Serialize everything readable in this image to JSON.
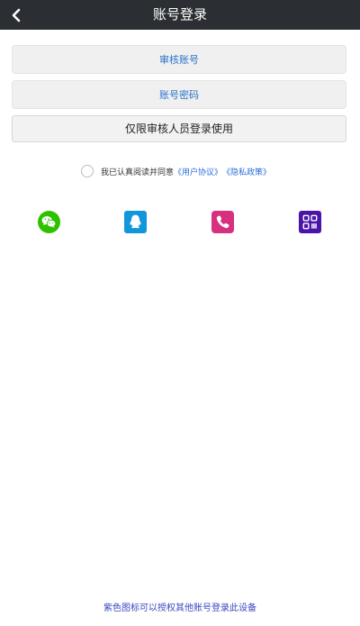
{
  "header": {
    "title": "账号登录",
    "back_icon": "chevron-left-icon"
  },
  "form": {
    "account_placeholder": "审核账号",
    "password_placeholder": "账号密码",
    "login_button_label": "仅限审核人员登录使用"
  },
  "agreement": {
    "prefix": "我已认真阅读并同意",
    "user_agreement": "《用户协议》",
    "privacy_policy": "《隐私政策》",
    "checked": false
  },
  "social_logins": [
    {
      "name": "wechat",
      "icon": "wechat-icon",
      "color": "#2dc100"
    },
    {
      "name": "qq",
      "icon": "qq-icon",
      "color": "#1296db"
    },
    {
      "name": "phone",
      "icon": "phone-icon",
      "color": "#d7307f"
    },
    {
      "name": "qrcode",
      "icon": "qrcode-icon",
      "color": "#4a14a8"
    }
  ],
  "footer": {
    "note": "紫色图标可以授权其他账号登录此设备"
  },
  "colors": {
    "navbar": "#2b2f33",
    "link": "#2c6fd8",
    "field_text": "#2c73c9",
    "footer_text": "#3b46c0"
  }
}
